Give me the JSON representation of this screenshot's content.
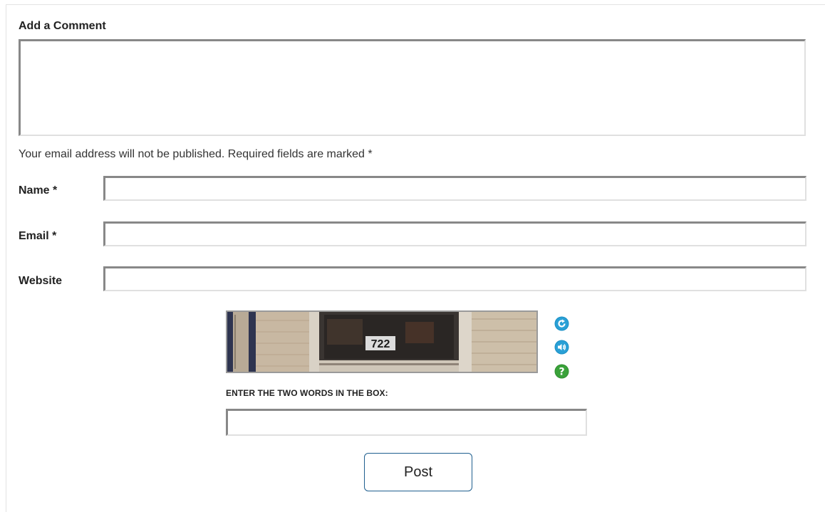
{
  "form": {
    "heading": "Add a Comment",
    "comment_value": "",
    "notice": "Your email address will not be published. Required fields are marked *",
    "fields": [
      {
        "label": "Name *",
        "value": ""
      },
      {
        "label": "Email *",
        "value": ""
      },
      {
        "label": "Website",
        "value": ""
      }
    ],
    "post_label": "Post"
  },
  "captcha": {
    "image_text": "722",
    "prompt": "ENTER THE TWO WORDS IN THE BOX:",
    "response_value": "",
    "icons": [
      "refresh-icon",
      "audio-icon",
      "help-icon"
    ]
  },
  "colors": {
    "refresh_icon": "#1a8fc4",
    "audio_icon": "#1a8fc4",
    "help_icon": "#3aa23a",
    "button_border": "#1f5f8f"
  }
}
